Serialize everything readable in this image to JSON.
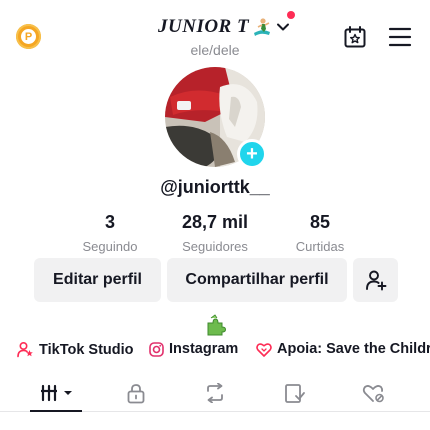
{
  "header": {
    "coin_letter": "P",
    "display_name": "JUNIOR T",
    "pronouns": "ele/dele"
  },
  "profile": {
    "username": "@juniorttk__",
    "stats": [
      {
        "value": "3",
        "label": "Seguindo"
      },
      {
        "value": "28,7 mil",
        "label": "Seguidores"
      },
      {
        "value": "85",
        "label": "Curtidas"
      }
    ],
    "add_badge": "+"
  },
  "actions": {
    "edit_label": "Editar perfil",
    "share_label": "Compartilhar perfil"
  },
  "links": [
    {
      "icon": "tiktok-studio-icon",
      "label": "TikTok Studio"
    },
    {
      "icon": "instagram-icon",
      "label": "Instagram"
    },
    {
      "icon": "heart-donate-icon",
      "label": "Apoia: Save the Children"
    }
  ],
  "tabs": [
    {
      "icon": "grid-videos-icon",
      "active": true
    },
    {
      "icon": "lock-icon",
      "active": false
    },
    {
      "icon": "repost-icon",
      "active": false
    },
    {
      "icon": "bookmark-icon",
      "active": false
    },
    {
      "icon": "liked-icon",
      "active": false
    }
  ],
  "colors": {
    "accent_cyan": "#20d5ec",
    "notification_red": "#fe2c55",
    "coin_orange": "#f5a623",
    "text_primary": "#161823",
    "text_secondary": "#8a8b91",
    "button_bg": "#f1f1f2"
  }
}
